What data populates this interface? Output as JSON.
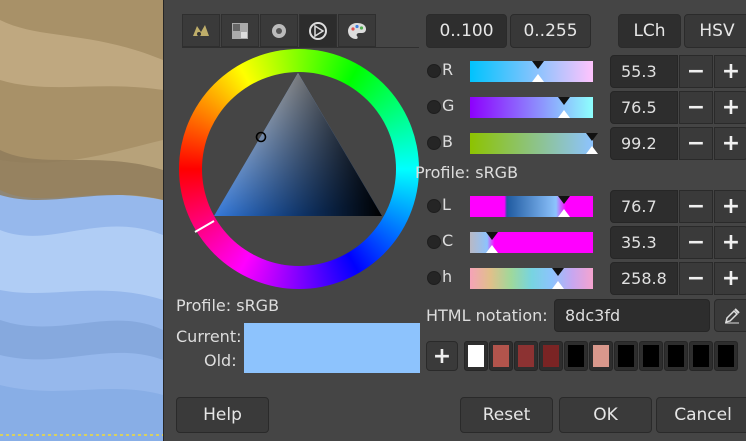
{
  "tabs": [
    {
      "name": "gimp-selector-icon"
    },
    {
      "name": "cmyk-selector-icon"
    },
    {
      "name": "watercolor-selector-icon"
    },
    {
      "name": "wheel-selector-icon",
      "active": true
    },
    {
      "name": "palette-selector-icon"
    }
  ],
  "wheel_profile": "Profile: sRGB",
  "current_label": "Current:",
  "old_label": "Old:",
  "range_buttons": {
    "r100": "0..100",
    "r255": "0..255"
  },
  "model_buttons": {
    "lch": "LCh",
    "hsv": "HSV"
  },
  "rgb": [
    {
      "label": "R",
      "value": "55.3",
      "fraction": 0.553
    },
    {
      "label": "G",
      "value": "76.5",
      "fraction": 0.765
    },
    {
      "label": "B",
      "value": "99.2",
      "fraction": 0.992
    }
  ],
  "lch_profile": "Profile: sRGB",
  "lch": [
    {
      "label": "L",
      "value": "76.7",
      "fraction": 0.767
    },
    {
      "label": "C",
      "value": "35.3",
      "fraction": 0.177
    },
    {
      "label": "h",
      "value": "258.8",
      "fraction": 0.719
    }
  ],
  "minus": "−",
  "plus": "+",
  "html_label": "HTML notation:",
  "html_value": "8dc3fd",
  "current_color": "#8dc3fd",
  "history_add": "+",
  "history": [
    "#ffffff",
    "#b2544c",
    "#8c3232",
    "#7a2424",
    "#000000",
    "#d9988c",
    "#000000",
    "#000000",
    "#000000",
    "#000000",
    "#000000"
  ],
  "buttons": {
    "help": "Help",
    "reset": "Reset",
    "ok": "OK",
    "cancel": "Cancel"
  }
}
